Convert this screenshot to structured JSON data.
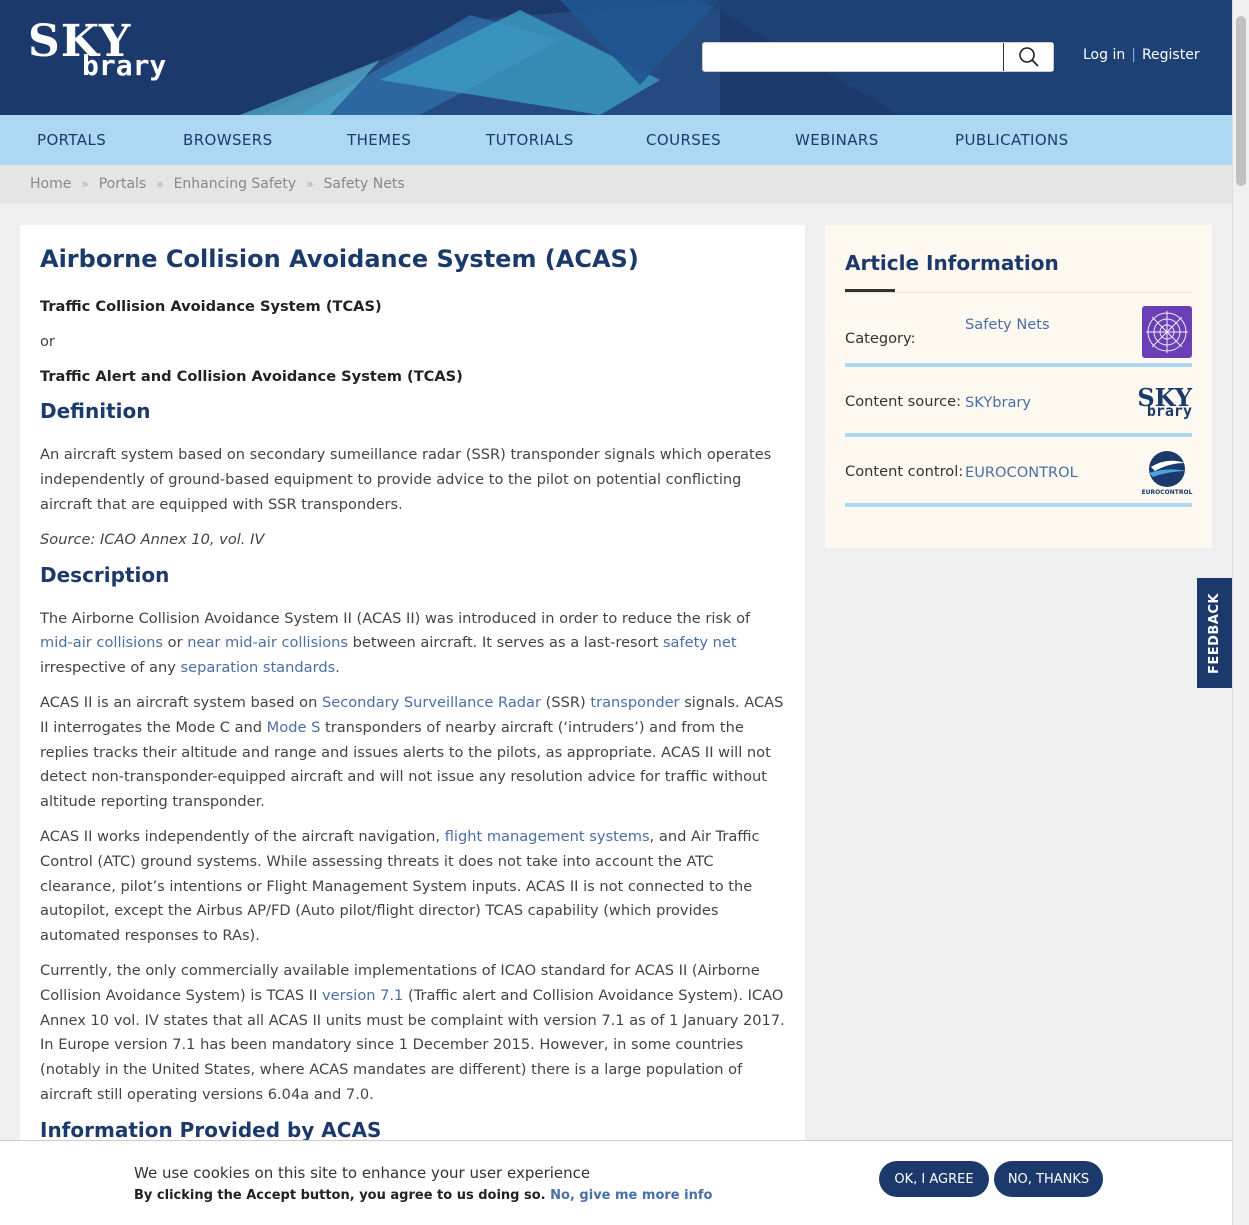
{
  "header": {
    "logo_top": "SKY",
    "logo_bottom": "brary",
    "search_placeholder": "",
    "login": "Log in",
    "separator": "|",
    "register": "Register"
  },
  "nav": [
    "PORTALS",
    "BROWSERS",
    "THEMES",
    "TUTORIALS",
    "COURSES",
    "WEBINARS",
    "PUBLICATIONS"
  ],
  "breadcrumb": {
    "items": [
      "Home",
      "Portals",
      "Enhancing Safety",
      "Safety Nets"
    ],
    "sep": "»"
  },
  "article": {
    "title": "Airborne Collision Avoidance System (ACAS)",
    "alt1": "Traffic Collision Avoidance System (TCAS)",
    "or": "or",
    "alt2": "Traffic Alert and Collision Avoidance System (TCAS)",
    "definition_heading": "Definition",
    "definition": "An aircraft system based on secondary sumeillance radar (SSR) transponder signals which operates independently of ground-based equipment to provide advice to the pilot on potential conflicting aircraft that are equipped with SSR transponders.",
    "source": "Source: ICAO Annex 10, vol. IV",
    "description_heading": "Description",
    "p1": {
      "a": "The Airborne Collision Avoidance System II (ACAS II) was introduced in order to reduce the risk of ",
      "link1": "mid-air collisions",
      "b": " or ",
      "link2": "near mid-air collisions",
      "c": " between aircraft. It serves as a last-resort ",
      "link3": "safety net",
      "d": " irrespective of any ",
      "link4": "separation standards",
      "e": "."
    },
    "p2": {
      "a": "ACAS II is an aircraft system based on ",
      "link1": "Secondary Surveillance Radar",
      "b": " (SSR) ",
      "link2": "transponder",
      "c": " signals. ACAS II interrogates the Mode C and ",
      "link3": "Mode S",
      "d": " transponders of nearby aircraft (‘intruders’) and from the replies tracks their altitude and range and issues alerts to the pilots, as appropriate. ACAS II will not detect non-transponder-equipped aircraft and will not issue any resolution advice for traffic without altitude reporting transponder."
    },
    "p3": {
      "a": "ACAS II works independently of the aircraft navigation, ",
      "link1": "flight management systems",
      "b": ", and Air Traffic Control (ATC) ground systems. While assessing threats it does not take into account the ATC clearance, pilot’s intentions or Flight Management System inputs. ACAS II is not connected to the autopilot, except the Airbus AP/FD (Auto pilot/flight director) TCAS capability (which provides automated responses to RAs)."
    },
    "p4": {
      "a": "Currently, the only commercially available implementations of ICAO standard for ACAS II (Airborne Collision Avoidance System) is TCAS II ",
      "link1": "version 7.1",
      "b": " (Traffic alert and Collision Avoidance System). ICAO Annex 10 vol. IV states that all ACAS II units must be complaint with version 7.1 as of 1 January 2017. In Europe version 7.1 has been mandatory since 1 December 2015. However, in some countries (notably in the United States, where ACAS mandates are different) there is a large population of aircraft still operating versions 6.04a and 7.0."
    },
    "next_heading": "Information Provided by ACAS"
  },
  "sidebar": {
    "title": "Article Information",
    "rows": [
      {
        "label": "Category:",
        "value": "Safety Nets"
      },
      {
        "label": "Content source:",
        "value": "SKYbrary"
      },
      {
        "label": "Content control:",
        "value": "EUROCONTROL"
      }
    ],
    "skybrary_logo_top": "SKY",
    "skybrary_logo_bottom": "brary",
    "eurocontrol_logo_text": "EUROCONTROL"
  },
  "feedback": "FEEDBACK",
  "cookie": {
    "line1": "We use cookies on this site to enhance your user experience",
    "line2": "By clicking the Accept button, you agree to us doing so.",
    "more_info": "No, give me more info",
    "agree": "OK, I AGREE",
    "decline": "NO, THANKS"
  },
  "colors": {
    "navy": "#1b3a6b",
    "nav_bg": "#add8f2",
    "link": "#4a6fa5"
  }
}
